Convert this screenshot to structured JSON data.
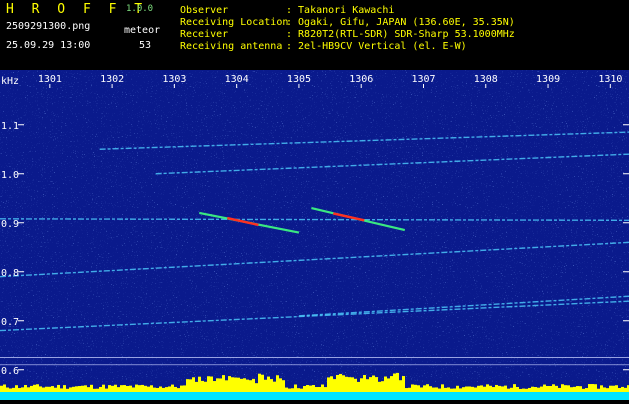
{
  "app": {
    "name": "H R O F F T",
    "version": "1.0.0",
    "filename": "2509291300.png",
    "datetime": "25.09.29 13:00",
    "meteor_label": "meteor",
    "meteor_count": "53"
  },
  "info": {
    "rows": [
      {
        "label": "Observer",
        "value": ": Takanori Kawachi"
      },
      {
        "label": "Receiving Location",
        "value": ": Ogaki, Gifu, JAPAN (136.60E, 35.35N)"
      },
      {
        "label": "Receiver",
        "value": ": R820T2(RTL-SDR) SDR-Sharp 53.1000MHz"
      },
      {
        "label": "Receiving antenna",
        "value": ": 2el-HB9CV Vertical (el. E-W)"
      }
    ]
  },
  "spectrogram": {
    "y_unit": "kHz",
    "y_ticks": [
      "1.1",
      "1.0",
      "0.9",
      "0.8",
      "0.7",
      "0.6"
    ],
    "y_tick_values": [
      1.1,
      1.0,
      0.9,
      0.8,
      0.7,
      0.6
    ],
    "y_range": [
      0.575,
      1.175
    ],
    "x_ticks": [
      "1301",
      "1302",
      "1303",
      "1304",
      "1305",
      "1306",
      "1307",
      "1308",
      "1309",
      "1310"
    ],
    "x_tick_values": [
      1301,
      1302,
      1303,
      1304,
      1305,
      1306,
      1307,
      1308,
      1309,
      1310
    ],
    "x_range": [
      1300.2,
      1310.3
    ],
    "background_color": "#0a1a8c",
    "trace_color": "#4fd0ff",
    "meteor_color": "#ff3020",
    "bar_color": "#ffff00",
    "bar_base_color": "#00e5ff",
    "traces": [
      {
        "x": [
          1300.2,
          1310.3
        ],
        "y": [
          0.908,
          0.905
        ]
      },
      {
        "x": [
          1301.8,
          1310.3
        ],
        "y": [
          1.05,
          1.085
        ]
      },
      {
        "x": [
          1302.7,
          1310.3
        ],
        "y": [
          1.0,
          1.04
        ]
      },
      {
        "x": [
          1300.2,
          1310.3
        ],
        "y": [
          0.79,
          0.86
        ]
      },
      {
        "x": [
          1300.2,
          1310.3
        ],
        "y": [
          0.68,
          0.74
        ]
      },
      {
        "x": [
          1305.0,
          1310.3
        ],
        "y": [
          0.71,
          0.75
        ]
      }
    ],
    "meteors": [
      {
        "x": [
          1303.4,
          1305.0
        ],
        "y": [
          0.92,
          0.88
        ],
        "peak": 1304.1
      },
      {
        "x": [
          1305.2,
          1306.7
        ],
        "y": [
          0.93,
          0.885
        ],
        "peak": 1305.8
      }
    ]
  }
}
